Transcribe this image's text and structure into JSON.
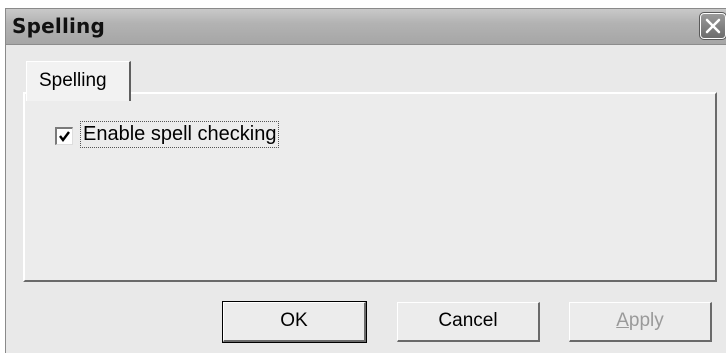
{
  "window": {
    "title": "Spelling",
    "close_icon": "close-icon"
  },
  "tabs": [
    {
      "label": "Spelling",
      "selected": true
    }
  ],
  "settings": {
    "spell_check_label": "Enable spell checking",
    "spell_check_checked": true
  },
  "buttons": {
    "ok": "OK",
    "cancel": "Cancel",
    "apply_mnemonic": "A",
    "apply_rest": "pply",
    "apply_enabled": false
  }
}
